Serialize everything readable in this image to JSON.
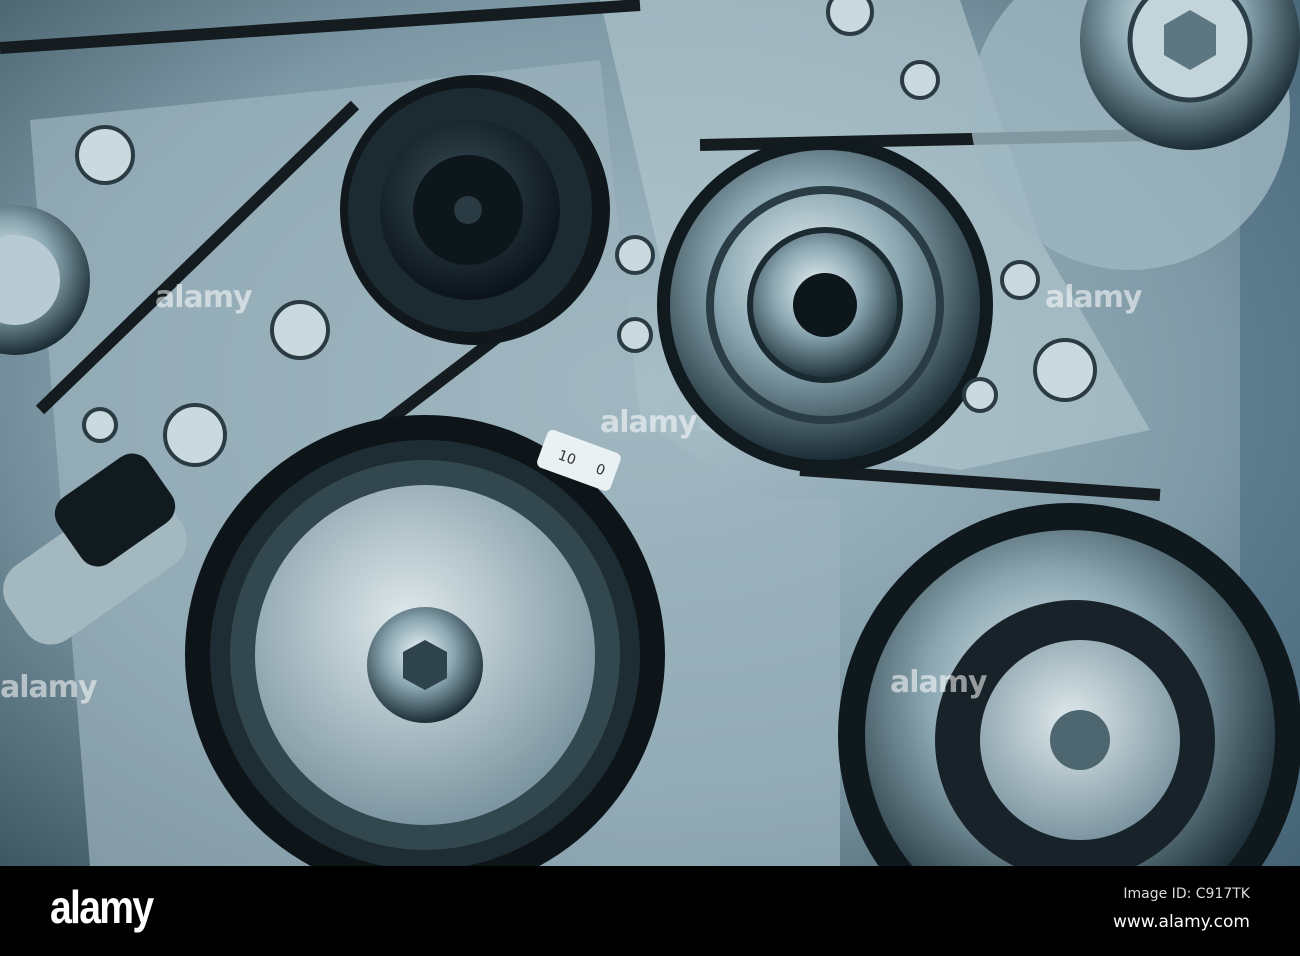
{
  "photo": {
    "subject": "engine-belt-pulleys",
    "tag_labels": [
      "10",
      "0"
    ],
    "watermark_text": "alamy",
    "palette": {
      "metal": "#8fa8b4",
      "dark": "#0d1a22",
      "chrome": "#c8dde4",
      "shadow": "#31464f"
    }
  },
  "footer": {
    "logo": "alamy",
    "image_id": "Image ID: C917TK",
    "url": "www.alamy.com"
  }
}
